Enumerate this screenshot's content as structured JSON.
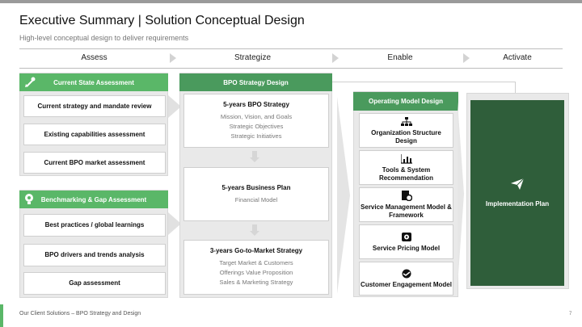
{
  "header": {
    "title": "Executive Summary | Solution Conceptual Design",
    "subtitle": "High-level conceptual design to deliver requirements"
  },
  "phases": [
    "Assess",
    "Strategize",
    "Enable",
    "Activate"
  ],
  "assess": {
    "current_state": {
      "header": "Current State Assessment",
      "items": [
        "Current strategy and mandate review",
        "Existing capabilities assessment",
        "Current BPO market assessment"
      ]
    },
    "benchmarking": {
      "header": "Benchmarking & Gap Assessment",
      "items": [
        "Best practices / global learnings",
        "BPO drivers and trends analysis",
        "Gap assessment"
      ]
    }
  },
  "strategize": {
    "header": "BPO Strategy Design",
    "cards": [
      {
        "title": "5-years BPO Strategy",
        "subs": [
          "Mission, Vision, and Goals",
          "Strategic Objectives",
          "Strategic Initiatives"
        ]
      },
      {
        "title": "5-years Business Plan",
        "subs": [
          "Financial Model"
        ]
      },
      {
        "title": "3-years Go-to-Market Strategy",
        "subs": [
          "Target Market & Customers",
          "Offerings Value Proposition",
          "Sales & Marketing Strategy"
        ]
      }
    ]
  },
  "enable": {
    "header": "Operating Model Design",
    "items": [
      {
        "label": "Organization Structure Design",
        "icon": "org-chart-icon"
      },
      {
        "label": "Tools & System Recommendation",
        "icon": "bar-chart-icon"
      },
      {
        "label": "Service Management Model & Framework",
        "icon": "document-gear-icon"
      },
      {
        "label": "Service Pricing Model",
        "icon": "pricing-icon"
      },
      {
        "label": "Customer Engagement Model",
        "icon": "handshake-icon"
      }
    ]
  },
  "activate": {
    "label": "Implementation Plan",
    "icon": "paper-plane-icon",
    "bg": "#2f5e3a"
  },
  "footer": {
    "text": "Our Client Solutions – BPO Strategy and Design",
    "page": "7"
  },
  "colors": {
    "accent": "#5ab768",
    "accent_dark": "#4a9a5d",
    "activate_bg": "#2f5e3a"
  }
}
